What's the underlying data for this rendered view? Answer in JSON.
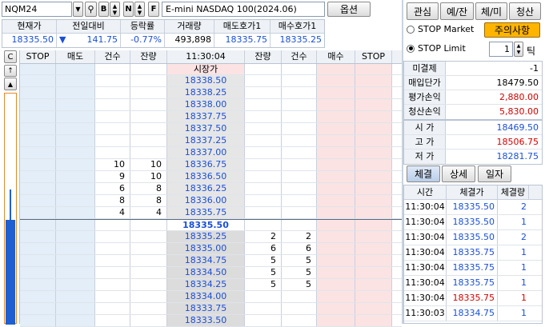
{
  "toolbar": {
    "symbol": "NQM24",
    "b_label": "B",
    "n_label": "N",
    "f_label": "F",
    "instrument": "E-mini NASDAQ 100(2024.06)",
    "options_label": "옵션"
  },
  "summary": {
    "headers": [
      "현재가",
      "전일대비",
      "등락률",
      "거래량",
      "매도호가1",
      "매수호가1"
    ],
    "values": [
      "18335.50",
      "141.75",
      "-0.77%",
      "493,898",
      "18335.75",
      "18335.25"
    ],
    "arrow": "▼"
  },
  "ladder": {
    "c_label": "C",
    "headers": [
      "STOP",
      "매도",
      "건수",
      "잔량",
      "11:30:04",
      "잔량",
      "건수",
      "매수",
      "STOP"
    ],
    "market_label": "시장가",
    "rows": [
      {
        "price": "18338.50",
        "ask_cnt": "",
        "ask_qty": "",
        "bid_qty": "",
        "bid_cnt": ""
      },
      {
        "price": "18338.25",
        "ask_cnt": "",
        "ask_qty": "",
        "bid_qty": "",
        "bid_cnt": ""
      },
      {
        "price": "18338.00",
        "ask_cnt": "",
        "ask_qty": "",
        "bid_qty": "",
        "bid_cnt": ""
      },
      {
        "price": "18337.75",
        "ask_cnt": "",
        "ask_qty": "",
        "bid_qty": "",
        "bid_cnt": ""
      },
      {
        "price": "18337.50",
        "ask_cnt": "",
        "ask_qty": "",
        "bid_qty": "",
        "bid_cnt": ""
      },
      {
        "price": "18337.25",
        "ask_cnt": "",
        "ask_qty": "",
        "bid_qty": "",
        "bid_cnt": ""
      },
      {
        "price": "18337.00",
        "ask_cnt": "",
        "ask_qty": "",
        "bid_qty": "",
        "bid_cnt": ""
      },
      {
        "price": "18336.75",
        "ask_cnt": "10",
        "ask_qty": "10",
        "bid_qty": "",
        "bid_cnt": ""
      },
      {
        "price": "18336.50",
        "ask_cnt": "9",
        "ask_qty": "10",
        "bid_qty": "",
        "bid_cnt": ""
      },
      {
        "price": "18336.25",
        "ask_cnt": "6",
        "ask_qty": "8",
        "bid_qty": "",
        "bid_cnt": ""
      },
      {
        "price": "18336.00",
        "ask_cnt": "8",
        "ask_qty": "8",
        "bid_qty": "",
        "bid_cnt": ""
      },
      {
        "price": "18335.75",
        "ask_cnt": "4",
        "ask_qty": "4",
        "bid_qty": "",
        "bid_cnt": ""
      },
      {
        "price": "18335.50",
        "ask_cnt": "",
        "ask_qty": "",
        "bid_qty": "",
        "bid_cnt": "",
        "current": true
      },
      {
        "price": "18335.25",
        "ask_cnt": "",
        "ask_qty": "",
        "bid_qty": "2",
        "bid_cnt": "2"
      },
      {
        "price": "18335.00",
        "ask_cnt": "",
        "ask_qty": "",
        "bid_qty": "6",
        "bid_cnt": "6"
      },
      {
        "price": "18334.75",
        "ask_cnt": "",
        "ask_qty": "",
        "bid_qty": "5",
        "bid_cnt": "5"
      },
      {
        "price": "18334.50",
        "ask_cnt": "",
        "ask_qty": "",
        "bid_qty": "5",
        "bid_cnt": "5"
      },
      {
        "price": "18334.25",
        "ask_cnt": "",
        "ask_qty": "",
        "bid_qty": "5",
        "bid_cnt": "5"
      },
      {
        "price": "18334.00",
        "ask_cnt": "",
        "ask_qty": "",
        "bid_qty": "",
        "bid_cnt": ""
      },
      {
        "price": "18333.75",
        "ask_cnt": "",
        "ask_qty": "",
        "bid_qty": "",
        "bid_cnt": ""
      },
      {
        "price": "18333.50",
        "ask_cnt": "",
        "ask_qty": "",
        "bid_qty": "",
        "bid_cnt": ""
      }
    ]
  },
  "right": {
    "tabs": [
      "관심",
      "예/잔",
      "체/미",
      "청산"
    ],
    "stop_market": "STOP Market",
    "stop_limit": "STOP Limit",
    "notice": "주의사항",
    "tick_value": "1",
    "tick_label": "틱",
    "info": [
      {
        "label": "미결제",
        "value": "-1",
        "color": "black"
      },
      {
        "label": "매입단가",
        "value": "18479.50",
        "color": "black"
      },
      {
        "label": "평가손익",
        "value": "2,880.00",
        "color": "red"
      },
      {
        "label": "청산손익",
        "value": "5,830.00",
        "color": "red"
      }
    ],
    "ohlc": [
      {
        "label": "시 가",
        "value": "18469.50",
        "color": "blue"
      },
      {
        "label": "고 가",
        "value": "18506.75",
        "color": "red"
      },
      {
        "label": "저 가",
        "value": "18281.75",
        "color": "blue"
      }
    ],
    "subtabs": [
      "체결",
      "상세",
      "일자"
    ],
    "trade_headers": [
      "시간",
      "체결가",
      "체결량"
    ],
    "trades": [
      {
        "time": "11:30:04",
        "price": "18335.50",
        "qty": "2",
        "color": "blue"
      },
      {
        "time": "11:30:04",
        "price": "18335.50",
        "qty": "1",
        "color": "blue"
      },
      {
        "time": "11:30:04",
        "price": "18335.50",
        "qty": "2",
        "color": "blue"
      },
      {
        "time": "11:30:04",
        "price": "18335.75",
        "qty": "1",
        "color": "blue"
      },
      {
        "time": "11:30:04",
        "price": "18335.75",
        "qty": "1",
        "color": "blue"
      },
      {
        "time": "11:30:04",
        "price": "18335.75",
        "qty": "1",
        "color": "blue"
      },
      {
        "time": "11:30:04",
        "price": "18335.75",
        "qty": "1",
        "color": "red"
      },
      {
        "time": "11:30:03",
        "price": "18334.75",
        "qty": "1",
        "color": "blue"
      }
    ]
  }
}
